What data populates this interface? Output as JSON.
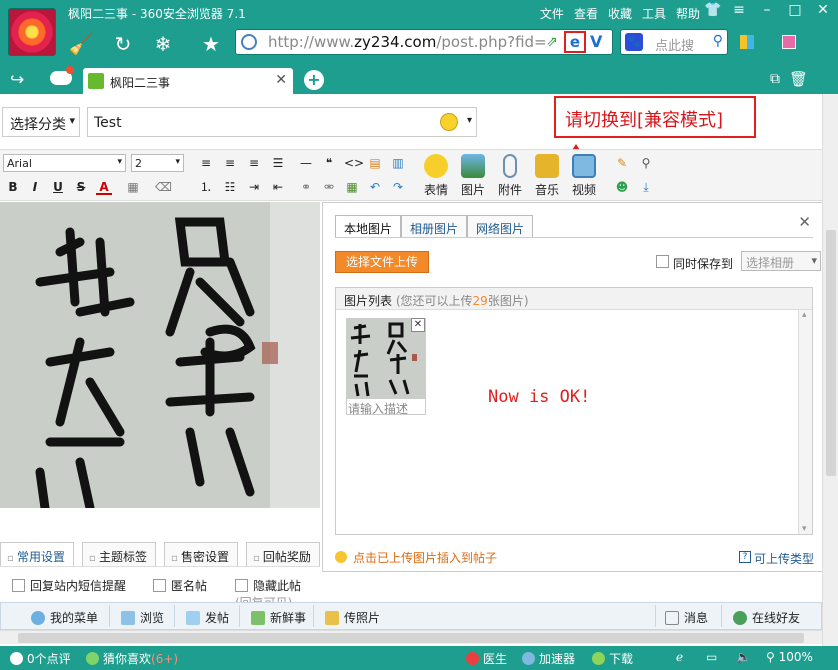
{
  "window": {
    "title": "枫阳二三事 - 360安全浏览器 7.1",
    "menu": [
      "文件",
      "查看",
      "收藏",
      "工具",
      "帮助"
    ],
    "controls": [
      "shirt-icon",
      "menu-icon",
      "minimize-icon",
      "maximize-icon",
      "close-icon"
    ]
  },
  "toolbar": {
    "address_url_prefix": "http://www.",
    "address_url_domain": "zy234.com",
    "address_url_path": "/post.php?fid=",
    "search_placeholder": "点此搜"
  },
  "tabs": {
    "active_title": "枫阳二三事"
  },
  "post_form": {
    "category_label": "选择分类",
    "title_value": "Test"
  },
  "callout": {
    "text": "请切换到[兼容模式]",
    "color": "#e0201f"
  },
  "editor": {
    "font": "Arial",
    "size": "2",
    "media_buttons": [
      {
        "label": "表情",
        "icon": "emoji-icon"
      },
      {
        "label": "图片",
        "icon": "image-icon"
      },
      {
        "label": "附件",
        "icon": "attachment-icon"
      },
      {
        "label": "音乐",
        "icon": "music-icon"
      },
      {
        "label": "视频",
        "icon": "video-icon"
      }
    ]
  },
  "upload_dialog": {
    "tabs": [
      "本地图片",
      "相册图片",
      "网络图片"
    ],
    "upload_button": "选择文件上传",
    "sync_label": "同时保存到",
    "album_select": "选择相册",
    "list_title": "图片列表",
    "list_hint_prefix": "(您还可以上传",
    "list_hint_count": "29",
    "list_hint_suffix": "张图片)",
    "thumb_desc_placeholder": "请输入描述",
    "now_ok": "Now is OK!",
    "tip": "点击已上传图片插入到帖子",
    "types_link": "可上传类型"
  },
  "settings": {
    "tabs": [
      "常用设置",
      "主题标签",
      "售密设置",
      "回帖奖励"
    ],
    "options": [
      {
        "label": "回复站内短信提醒",
        "note": ""
      },
      {
        "label": "匿名帖",
        "note": ""
      },
      {
        "label": "隐藏此帖",
        "note": "(回复可见)"
      }
    ]
  },
  "site_bar": {
    "items": [
      "我的菜单",
      "浏览",
      "发帖",
      "新鲜事",
      "传照片"
    ],
    "right_items": [
      "消息",
      "在线好友"
    ]
  },
  "status": {
    "comments": "0个点评",
    "guess": "猜你喜欢",
    "guess_count": "(6+)",
    "doctor": "医生",
    "accelerator": "加速器",
    "download": "下载",
    "zoom": "100%"
  },
  "colors": {
    "chrome": "#1d9e8f",
    "accent_orange": "#f28a2a",
    "link_blue": "#225c94",
    "alert_red": "#e0201f"
  }
}
